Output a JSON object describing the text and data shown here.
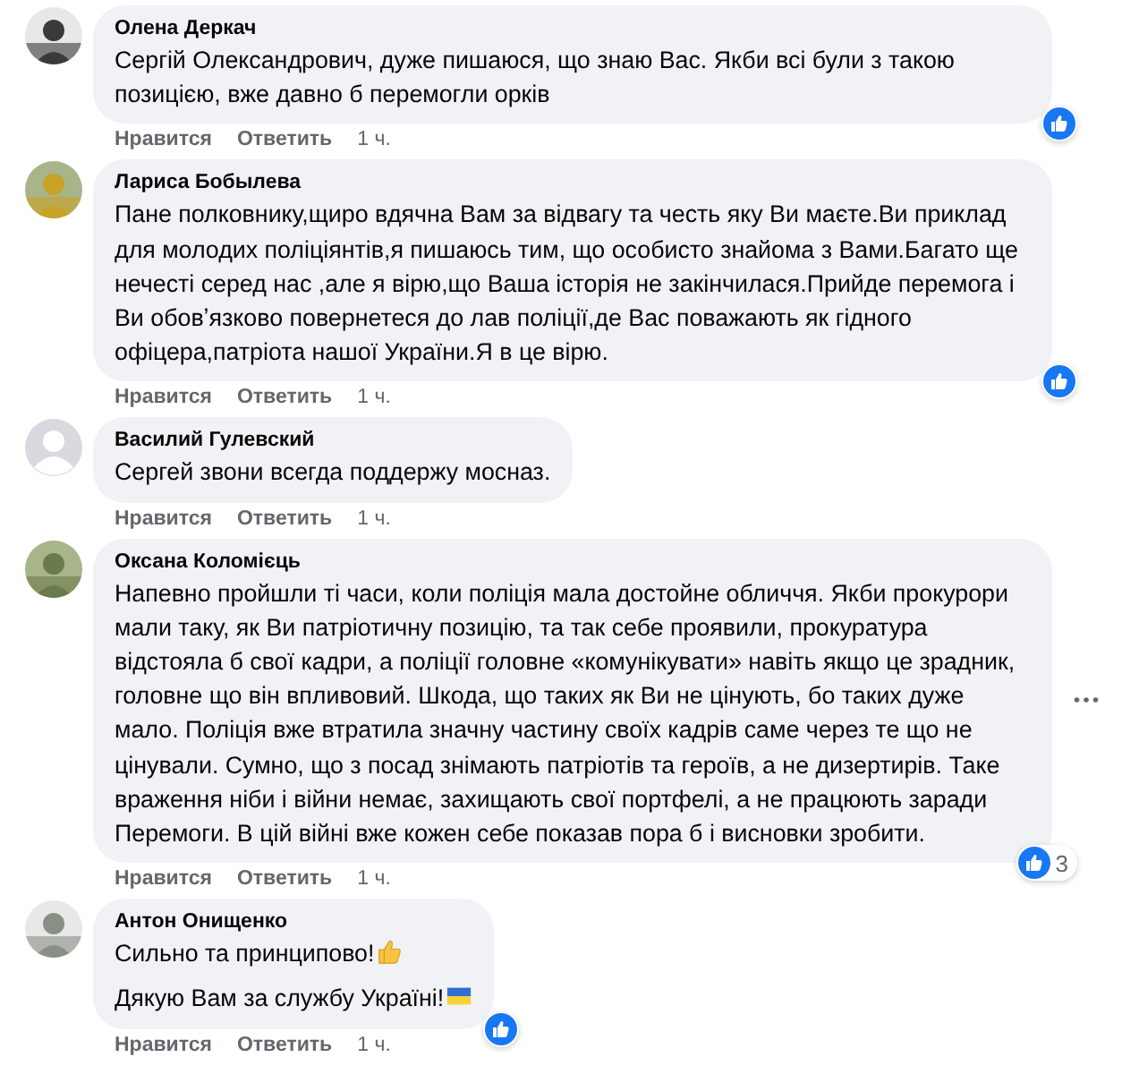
{
  "comments": [
    {
      "author": "Олена Деркач",
      "default_avatar": false,
      "paragraphs": [
        {
          "text": "Сергій Олександрович, дуже пишаюся, що знаю Вас. Якби всі були з такою позицією, вже давно б перемогли орків",
          "thumbs_up": false,
          "flag": false
        }
      ],
      "like_label": "Нравится",
      "reply_label": "Ответить",
      "time": "1 ч.",
      "reaction": true,
      "menu": false
    },
    {
      "author": "Лариса Бобылева",
      "default_avatar": false,
      "paragraphs": [
        {
          "text": "Пане полковнику,щиро вдячна Вам за відвагу та честь яку Ви маєте.Ви приклад для молодих поліціянтів,я пишаюсь тим, що особисто знайома з Вами.Багато ще нечесті серед нас ,але я вірю,що Ваша історія не закінчилася.Прийде перемога і Ви обовʼязково повернетеся до лав поліції,де Вас поважають як гідного офіцера,патріота нашої України.Я в це вірю.",
          "thumbs_up": false,
          "flag": false
        }
      ],
      "like_label": "Нравится",
      "reply_label": "Ответить",
      "time": "1 ч.",
      "reaction": true,
      "menu": false
    },
    {
      "author": "Василий Гулевский",
      "default_avatar": true,
      "paragraphs": [
        {
          "text": "Сергей звони всегда поддержу мосназ.",
          "thumbs_up": false,
          "flag": false
        }
      ],
      "like_label": "Нравится",
      "reply_label": "Ответить",
      "time": "1 ч.",
      "reaction": false,
      "menu": false
    },
    {
      "author": "Оксана Коломієць",
      "default_avatar": false,
      "paragraphs": [
        {
          "text": "Напевно пройшли ті часи, коли поліція мала достойне обличчя. Якби прокурори мали таку, як Ви патріотичну позицію, та так себе проявили, прокуратура відстояла б свої кадри, а поліції головне «комунікувати» навіть якщо це зрадник, головне що він впливовий. Шкода, що таких як Ви не цінують, бо таких дуже мало. Поліція вже втратила значну частину своїх кадрів саме через те що не цінували. Сумно, що з посад знімають патріотів та героїв, а не дизертирів. Таке враження ніби і війни немає, захищають свої портфелі, а не працюють заради Перемоги. В цій війні вже кожен себе показав пора б і висновки зробити.",
          "thumbs_up": false,
          "flag": false
        }
      ],
      "like_label": "Нравится",
      "reply_label": "Ответить",
      "time": "1 ч.",
      "reaction": true,
      "reaction_count": "3",
      "menu": true
    },
    {
      "author": "Антон Онищенко",
      "default_avatar": false,
      "paragraphs": [
        {
          "text": "Сильно та принципово!",
          "thumbs_up": true,
          "flag": false
        },
        {
          "text": "Дякую Вам за службу Україні!",
          "thumbs_up": false,
          "flag": true
        }
      ],
      "like_label": "Нравится",
      "reply_label": "Ответить",
      "time": "1 ч.",
      "reaction": true,
      "menu": false
    }
  ]
}
